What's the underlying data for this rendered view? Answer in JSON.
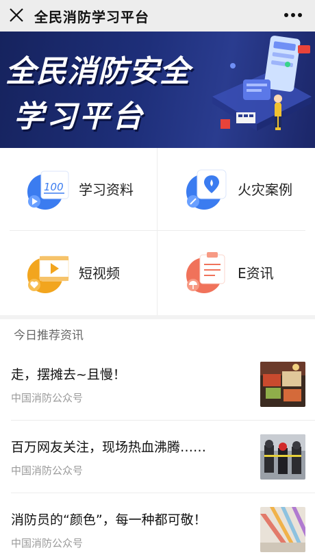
{
  "header": {
    "title": "全民消防学习平台",
    "close_icon": "close-icon",
    "more_icon": "more-icon"
  },
  "banner": {
    "line1": "全民消防安全",
    "line2": "学习平台"
  },
  "menu": [
    {
      "label": "学习资料",
      "icon": "study-materials-icon",
      "accent": "#3b7cf0"
    },
    {
      "label": "火灾案例",
      "icon": "fire-cases-icon",
      "accent": "#3b7cf0"
    },
    {
      "label": "短视频",
      "icon": "short-video-icon",
      "accent": "#f2a51e"
    },
    {
      "label": "E资讯",
      "icon": "e-news-icon",
      "accent": "#f0725a"
    }
  ],
  "news_section": {
    "heading": "今日推荐资讯",
    "items": [
      {
        "title": "走，摆摊去~且慢！",
        "source": "中国消防公众号"
      },
      {
        "title": "百万网友关注，现场热血沸腾……",
        "source": "中国消防公众号"
      },
      {
        "title": "消防员的“颜色”，每一种都可敬！",
        "source": "中国消防公众号"
      }
    ]
  }
}
